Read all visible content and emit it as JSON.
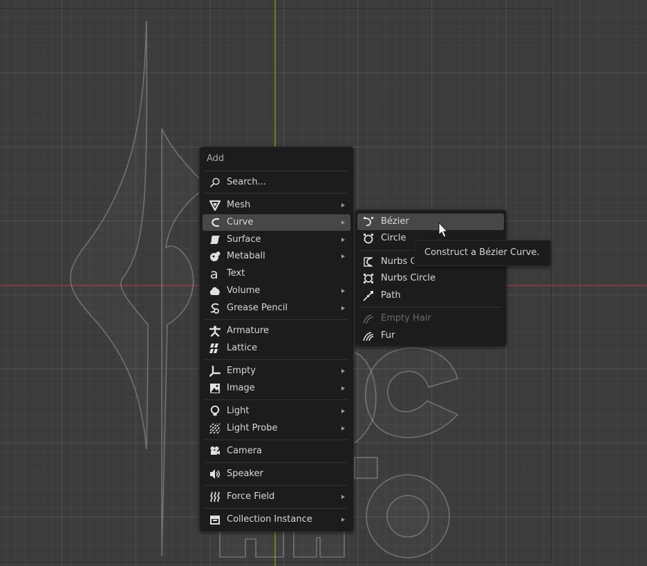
{
  "add_menu": {
    "title": "Add",
    "search_label": "Search...",
    "items": [
      {
        "label": "Mesh",
        "icon": "mesh-icon",
        "submenu": true
      },
      {
        "label": "Curve",
        "icon": "curve-icon",
        "submenu": true,
        "active": true
      },
      {
        "label": "Surface",
        "icon": "surface-icon",
        "submenu": true
      },
      {
        "label": "Metaball",
        "icon": "metaball-icon",
        "submenu": true
      },
      {
        "label": "Text",
        "icon": "text-icon",
        "submenu": false
      },
      {
        "label": "Volume",
        "icon": "volume-icon",
        "submenu": true
      },
      {
        "label": "Grease Pencil",
        "icon": "grease-pencil-icon",
        "submenu": true
      },
      {
        "label": "Armature",
        "icon": "armature-icon",
        "submenu": false
      },
      {
        "label": "Lattice",
        "icon": "lattice-icon",
        "submenu": false
      },
      {
        "label": "Empty",
        "icon": "empty-icon",
        "submenu": true
      },
      {
        "label": "Image",
        "icon": "image-icon",
        "submenu": true
      },
      {
        "label": "Light",
        "icon": "light-icon",
        "submenu": true
      },
      {
        "label": "Light Probe",
        "icon": "light-probe-icon",
        "submenu": true
      },
      {
        "label": "Camera",
        "icon": "camera-icon",
        "submenu": false
      },
      {
        "label": "Speaker",
        "icon": "speaker-icon",
        "submenu": false
      },
      {
        "label": "Force Field",
        "icon": "force-field-icon",
        "submenu": true
      },
      {
        "label": "Collection Instance",
        "icon": "collection-instance-icon",
        "submenu": true
      }
    ]
  },
  "curve_submenu": {
    "items": [
      {
        "label": "Bézier",
        "icon": "bezier-icon",
        "active": true
      },
      {
        "label": "Circle",
        "icon": "circle-curve-icon"
      },
      {
        "label": "Nurbs Curve",
        "icon": "nurbs-curve-icon"
      },
      {
        "label": "Nurbs Circle",
        "icon": "nurbs-circle-icon"
      },
      {
        "label": "Path",
        "icon": "path-icon"
      },
      {
        "label": "Empty Hair",
        "icon": "empty-hair-icon",
        "disabled": true
      },
      {
        "label": "Fur",
        "icon": "fur-icon"
      }
    ]
  },
  "tooltip": {
    "text": "Construct a Bézier Curve."
  },
  "colors": {
    "menu_bg": "#1c1c1c",
    "highlight": "#474747",
    "x_axis": "#7e3a44",
    "y_axis": "#6e7a2e"
  }
}
